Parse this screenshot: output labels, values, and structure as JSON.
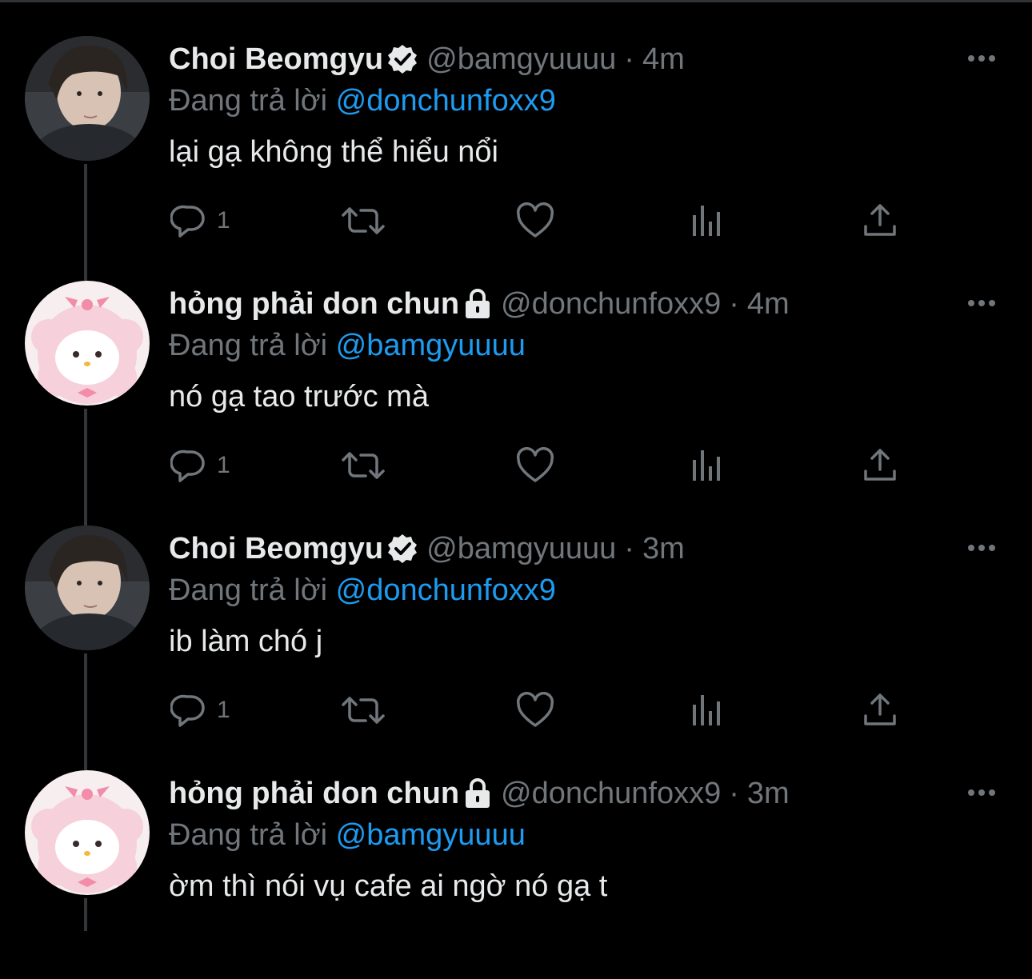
{
  "tweets": [
    {
      "name": "Choi Beomgyu",
      "badge": "verified-icon",
      "handle": "@bamgyuuuu",
      "separator": "·",
      "time": "4m",
      "reply_prefix": "Đang trả lời",
      "reply_to": "@donchunfoxx9",
      "text": "lại gạ không thể hiểu nổi",
      "reply_count": "1"
    },
    {
      "name": "hỏng phải don chun",
      "badge": "lock-icon",
      "handle": "@donchunfoxx9",
      "separator": "·",
      "time": "4m",
      "reply_prefix": "Đang trả lời",
      "reply_to": "@bamgyuuuu",
      "text": "nó gạ tao trước mà",
      "reply_count": "1"
    },
    {
      "name": "Choi Beomgyu",
      "badge": "verified-icon",
      "handle": "@bamgyuuuu",
      "separator": "·",
      "time": "3m",
      "reply_prefix": "Đang trả lời",
      "reply_to": "@donchunfoxx9",
      "text": "ib làm chó j",
      "reply_count": "1"
    },
    {
      "name": "hỏng phải don chun",
      "badge": "lock-icon",
      "handle": "@donchunfoxx9",
      "separator": "·",
      "time": "3m",
      "reply_prefix": "Đang trả lời",
      "reply_to": "@bamgyuuuu",
      "text": "ờm thì nói vụ cafe ai ngờ nó gạ t",
      "reply_count": ""
    }
  ],
  "colors": {
    "background": "#000000",
    "text_primary": "#e7e9ea",
    "text_secondary": "#71767b",
    "mention": "#1d9bf0",
    "thread_line": "#333639"
  }
}
